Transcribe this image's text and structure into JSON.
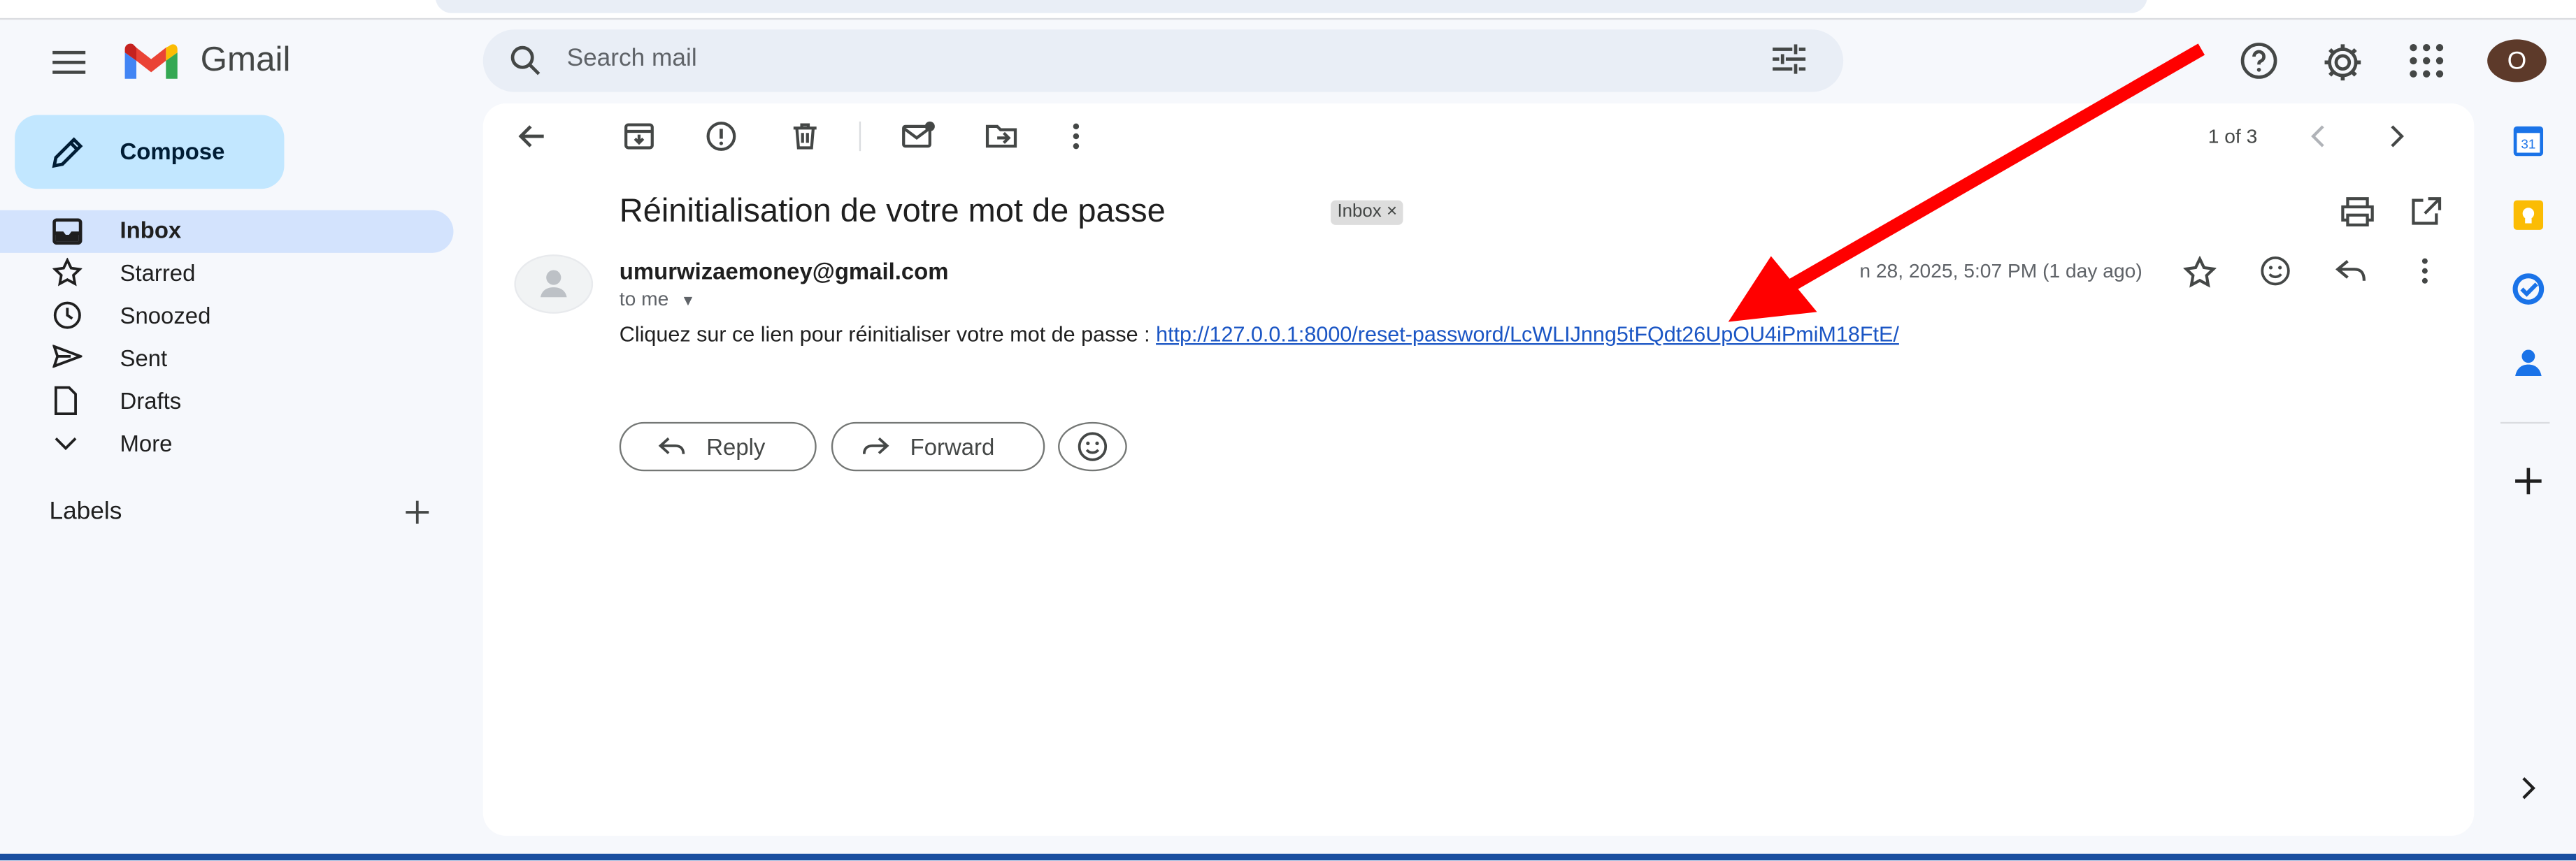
{
  "app": {
    "name": "Gmail"
  },
  "search": {
    "placeholder": "Search mail"
  },
  "account": {
    "initial": "O"
  },
  "compose": {
    "label": "Compose"
  },
  "nav": {
    "items": [
      {
        "label": "Inbox",
        "icon": "inbox-icon",
        "active": true
      },
      {
        "label": "Starred",
        "icon": "star-icon"
      },
      {
        "label": "Snoozed",
        "icon": "clock-icon"
      },
      {
        "label": "Sent",
        "icon": "send-icon"
      },
      {
        "label": "Drafts",
        "icon": "draft-icon"
      },
      {
        "label": "More",
        "icon": "chevron-down-icon"
      }
    ],
    "labels_title": "Labels"
  },
  "toolbar": {
    "pager": "1 of 3"
  },
  "email": {
    "subject": "Réinitialisation de votre mot de passe",
    "chip": "Inbox",
    "sender": "umurwizaemoney@gmail.com",
    "recipient": "to me",
    "date": "n 28, 2025, 5:07 PM (1 day ago)",
    "body_prefix": "Cliquez sur ce lien pour réinitialiser votre mot de passe : ",
    "link": "http://127.0.0.1:8000/reset-password/LcWLIJnng5tFQdt26UpOU4iPmiM18FtE/"
  },
  "actions": {
    "reply": "Reply",
    "forward": "Forward"
  },
  "colors": {
    "accent": "#c2e7ff",
    "active_nav": "#d3e3fd",
    "annotation_arrow": "#ff0000",
    "link": "#1a55c4"
  }
}
